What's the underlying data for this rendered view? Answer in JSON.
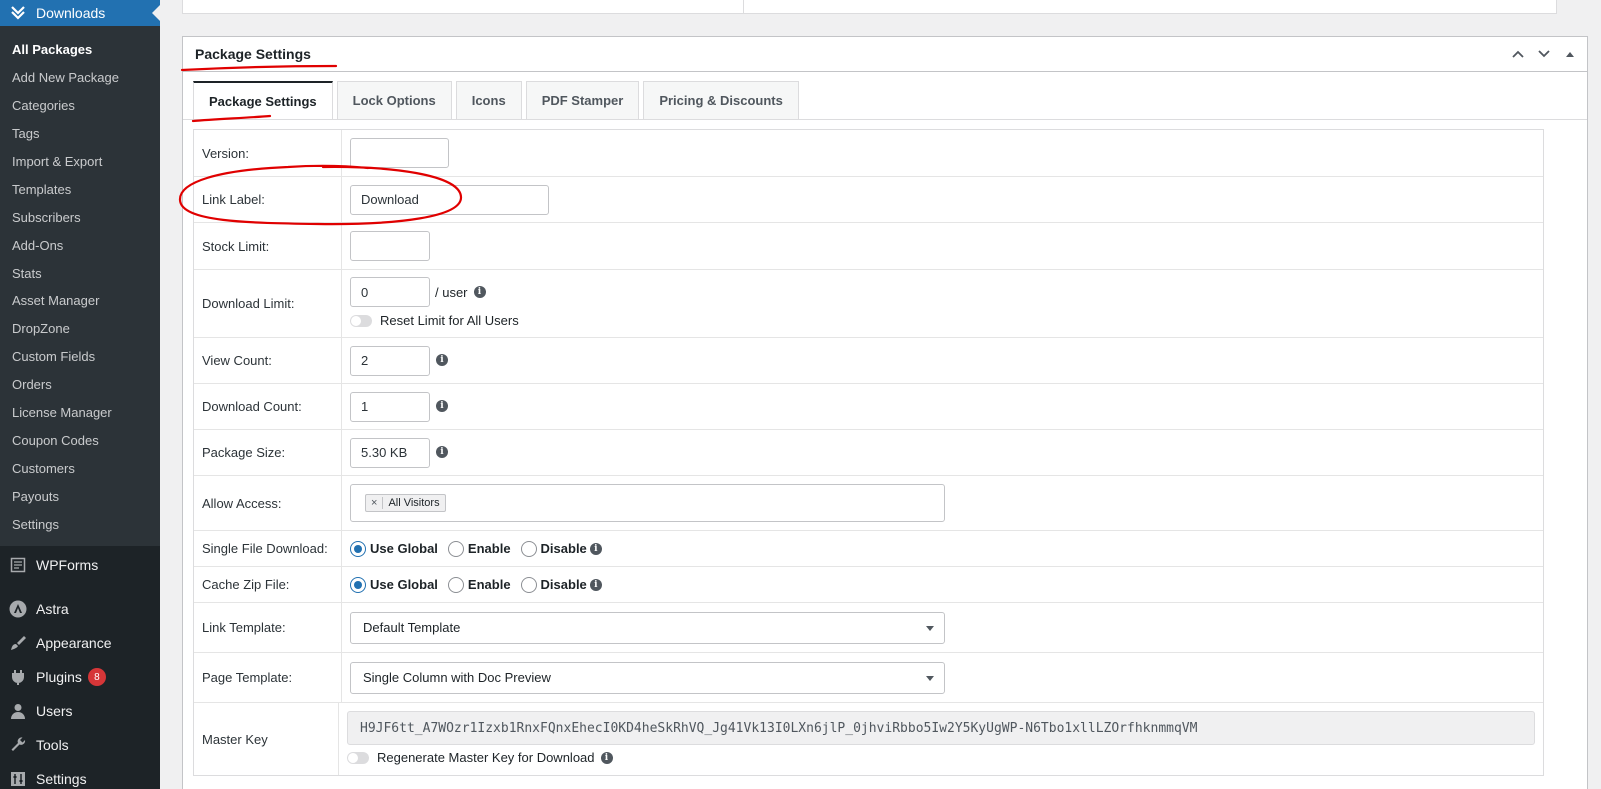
{
  "sidebar": {
    "current": "Downloads",
    "submenu": [
      "All Packages",
      "Add New Package",
      "Categories",
      "Tags",
      "Import & Export",
      "Templates",
      "Subscribers",
      "Add-Ons",
      "Stats",
      "Asset Manager",
      "DropZone",
      "Custom Fields",
      "Orders",
      "License Manager",
      "Coupon Codes",
      "Customers",
      "Payouts",
      "Settings"
    ],
    "top_items": [
      {
        "label": "WPForms",
        "icon": "wpforms-icon"
      },
      {
        "label": "Astra",
        "icon": "astra-icon"
      },
      {
        "label": "Appearance",
        "icon": "brush-icon"
      },
      {
        "label": "Plugins",
        "icon": "plug-icon",
        "badge": "8"
      },
      {
        "label": "Users",
        "icon": "user-icon"
      },
      {
        "label": "Tools",
        "icon": "wrench-icon"
      },
      {
        "label": "Settings",
        "icon": "settings-icon"
      }
    ]
  },
  "postbox": {
    "title": "Package Settings",
    "tabs": [
      "Package Settings",
      "Lock Options",
      "Icons",
      "PDF Stamper",
      "Pricing & Discounts"
    ]
  },
  "fields": {
    "version": {
      "label": "Version:",
      "value": ""
    },
    "link_label": {
      "label": "Link Label:",
      "value": "Download"
    },
    "stock_limit": {
      "label": "Stock Limit:",
      "value": ""
    },
    "download_limit": {
      "label": "Download Limit:",
      "value": "0",
      "suffix": "/ user",
      "toggle_label": "Reset Limit for All Users"
    },
    "view_count": {
      "label": "View Count:",
      "value": "2"
    },
    "download_count": {
      "label": "Download Count:",
      "value": "1"
    },
    "package_size": {
      "label": "Package Size:",
      "value": "5.30 KB"
    },
    "allow_access": {
      "label": "Allow Access:",
      "chip": "All Visitors"
    },
    "single_file_download": {
      "label": "Single File Download:",
      "options": [
        "Use Global",
        "Enable",
        "Disable"
      ],
      "selected": "Use Global"
    },
    "cache_zip": {
      "label": "Cache Zip File:",
      "options": [
        "Use Global",
        "Enable",
        "Disable"
      ],
      "selected": "Use Global"
    },
    "link_template": {
      "label": "Link Template:",
      "value": "Default Template"
    },
    "page_template": {
      "label": "Page Template:",
      "value": "Single Column with Doc Preview"
    },
    "master_key": {
      "label": "Master Key",
      "value": "H9JF6tt_A7WOzr1Izxb1RnxFQnxEhecI0KD4heSkRhVQ_Jg41Vk13I0LXn6jlP_0jhviRbbo5Iw2Y5KyUgWP-N6Tbo1xllLZOrfhknmmqVM",
      "toggle_label": "Regenerate Master Key for Download"
    }
  },
  "colors": {
    "accent": "#2271b1",
    "annotation": "#e00000",
    "sidebar_bg": "#1d2327"
  }
}
